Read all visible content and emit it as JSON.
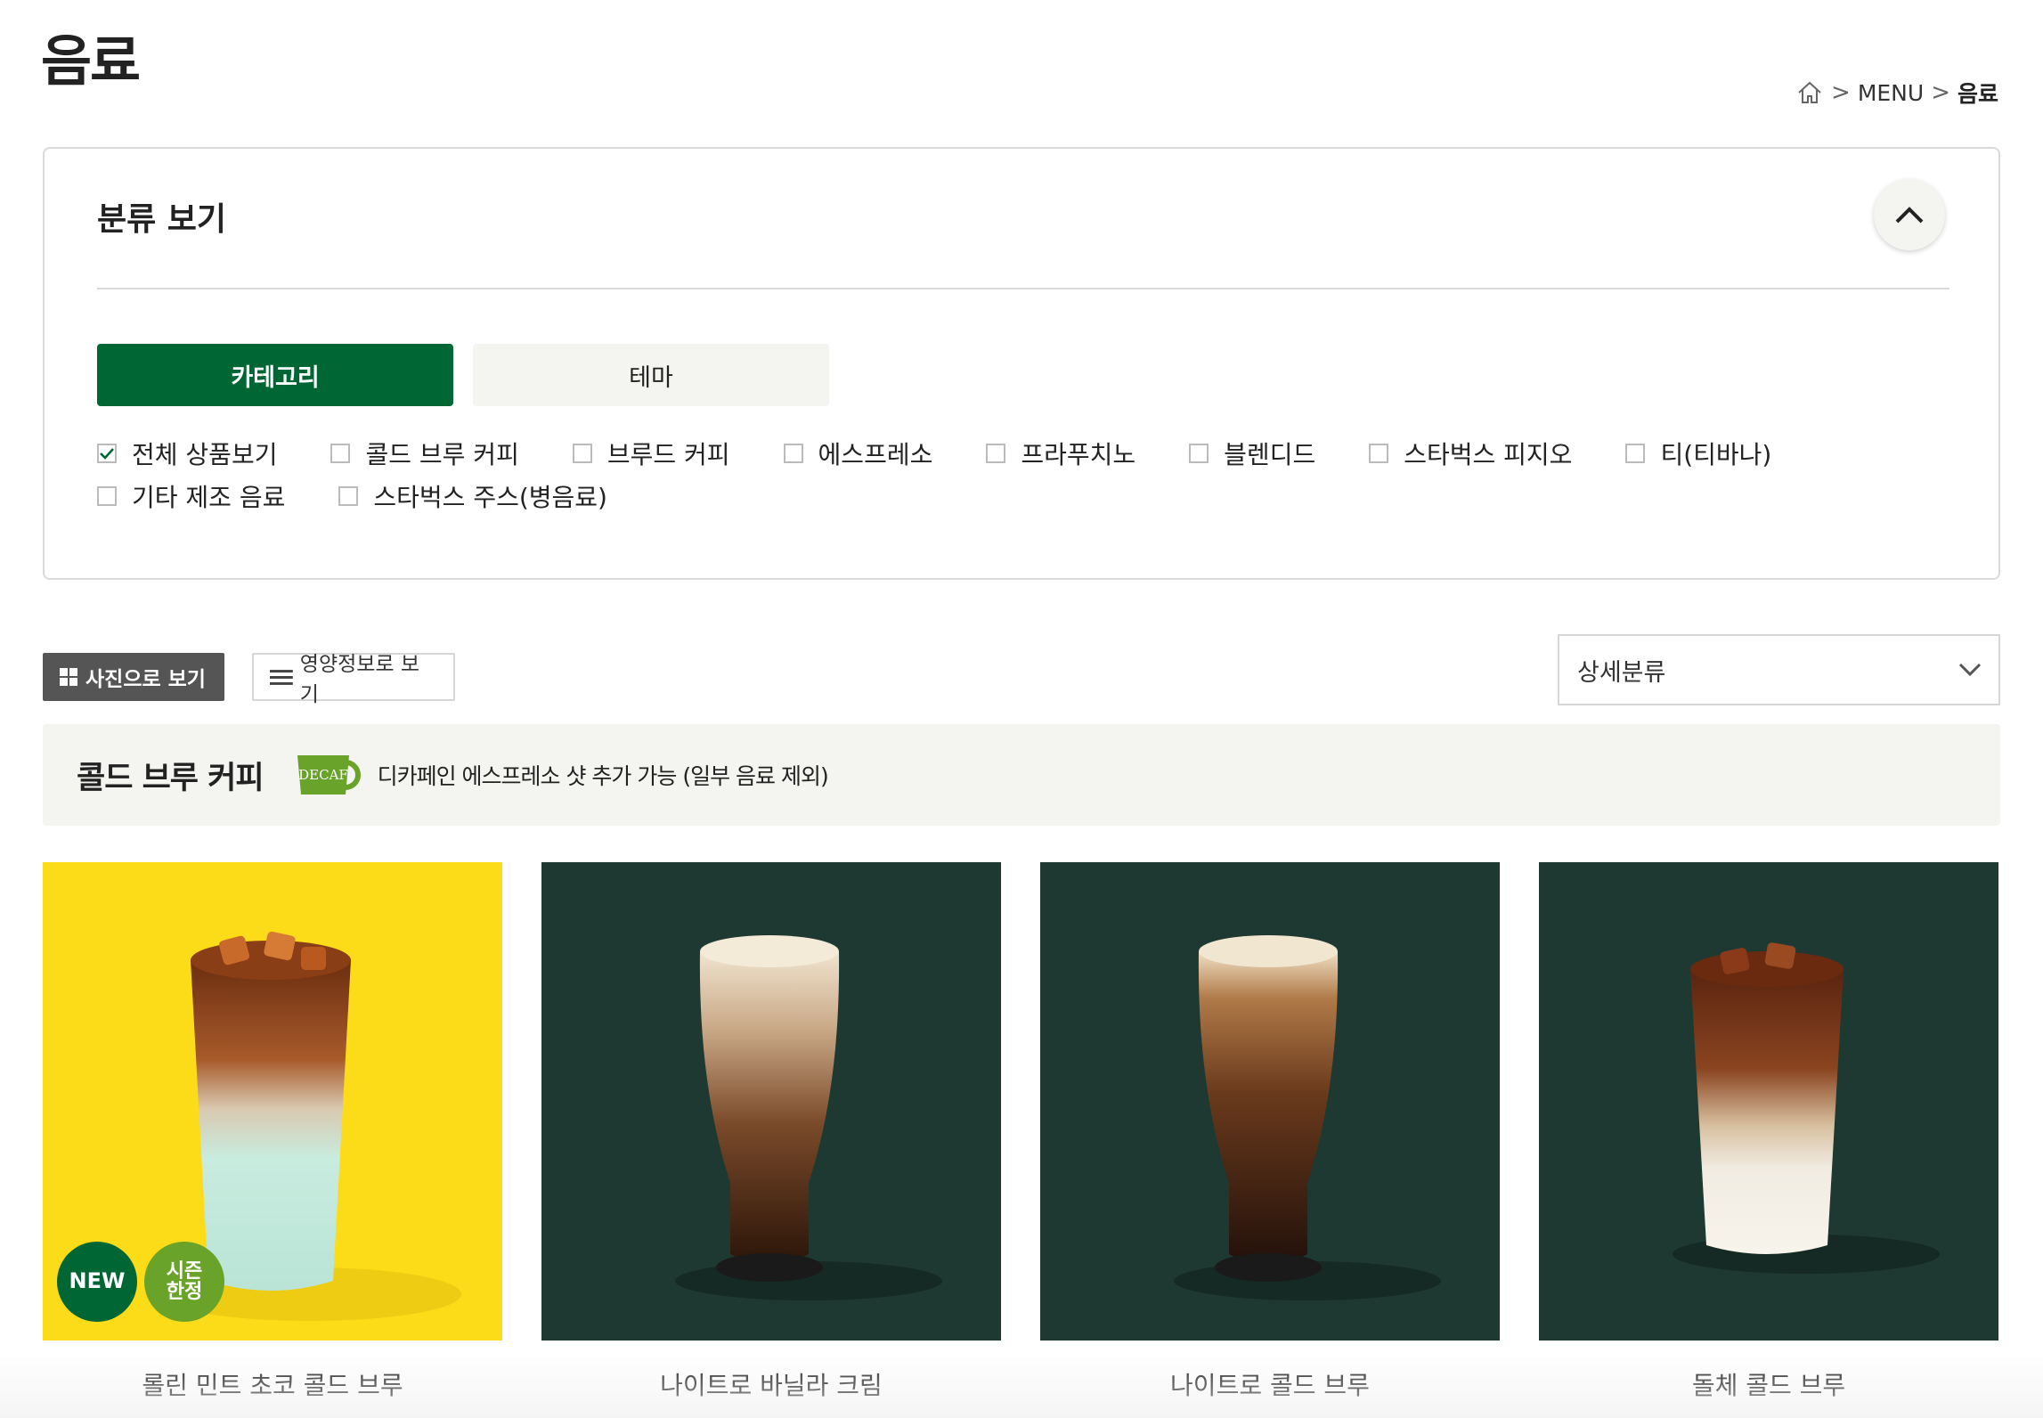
{
  "page": {
    "title": "음료"
  },
  "breadcrumb": {
    "home_icon": "home-icon",
    "items": [
      "MENU",
      "음료"
    ]
  },
  "filter": {
    "title": "분류 보기",
    "collapse_icon": "chevron-up-icon",
    "tabs": [
      {
        "label": "카테고리",
        "active": true
      },
      {
        "label": "테마",
        "active": false
      }
    ],
    "categories_row1": [
      {
        "label": "전체 상품보기",
        "checked": true
      },
      {
        "label": "콜드 브루 커피",
        "checked": false
      },
      {
        "label": "브루드 커피",
        "checked": false
      },
      {
        "label": "에스프레소",
        "checked": false
      },
      {
        "label": "프라푸치노",
        "checked": false
      },
      {
        "label": "블렌디드",
        "checked": false
      },
      {
        "label": "스타벅스 피지오",
        "checked": false
      },
      {
        "label": "티(티바나)",
        "checked": false
      }
    ],
    "categories_row2": [
      {
        "label": "기타 제조 음료",
        "checked": false
      },
      {
        "label": "스타벅스 주스(병음료)",
        "checked": false
      }
    ]
  },
  "view": {
    "photo_label": "사진으로 보기",
    "nutrition_label": "영양정보로 보기",
    "photo_icon": "grid-icon",
    "nutrition_icon": "list-icon"
  },
  "detail_select": {
    "value": "상세분류",
    "icon": "chevron-down-icon"
  },
  "section": {
    "title": "콜드 브루 커피",
    "badge_text": "DECAF",
    "note": "디카페인 에스프레소 샷 추가 가능 (일부 음료 제외)"
  },
  "products": [
    {
      "name": "롤린 민트 초코 콜드 브루",
      "badges": [
        "NEW",
        "시즌\n한정"
      ],
      "bg": "#fcdb18"
    },
    {
      "name": "나이트로 바닐라 크림",
      "badges": [],
      "bg": "#1e3932"
    },
    {
      "name": "나이트로 콜드 브루",
      "badges": [],
      "bg": "#1e3932"
    },
    {
      "name": "돌체 콜드 브루",
      "badges": [],
      "bg": "#1e3932"
    }
  ],
  "colors": {
    "brand_green": "#006633",
    "season_green": "#6aa329",
    "product_dark_bg": "#1e3932",
    "product_yellow_bg": "#fcdb18",
    "neutral_bg": "#f4f4f1"
  }
}
